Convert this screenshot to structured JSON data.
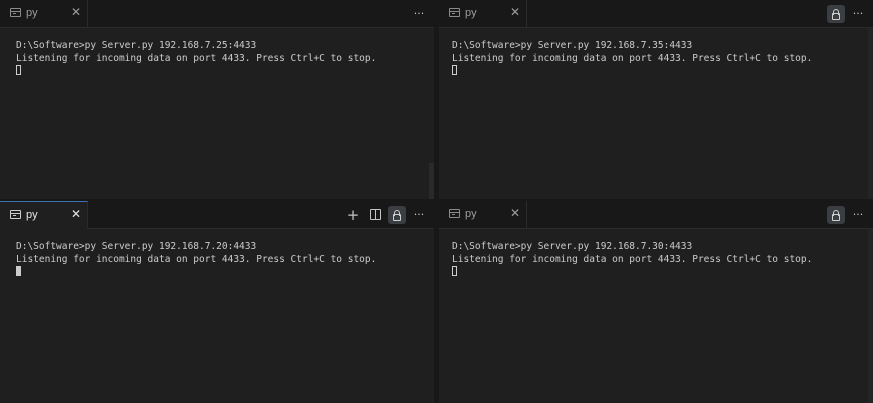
{
  "panes": {
    "top_left": {
      "tab_label": "py",
      "prompt": "D:\\Software>py Server.py 192.168.7.25:4433",
      "output": "Listening for incoming data on port 4433. Press Ctrl+C to stop."
    },
    "top_right": {
      "tab_label": "py",
      "prompt": "D:\\Software>py Server.py 192.168.7.35:4433",
      "output": "Listening for incoming data on port 4433. Press Ctrl+C to stop."
    },
    "bottom_left": {
      "tab_label": "py",
      "prompt": "D:\\Software>py Server.py 192.168.7.20:4433",
      "output": "Listening for incoming data on port 4433. Press Ctrl+C to stop."
    },
    "bottom_right": {
      "tab_label": "py",
      "prompt": "D:\\Software>py Server.py 192.168.7.30:4433",
      "output": "Listening for incoming data on port 4433. Press Ctrl+C to stop."
    }
  },
  "icons": {
    "close": "close-icon",
    "more": "more-actions-icon",
    "lock": "lock-icon",
    "split": "split-editor-icon",
    "add": "plus-icon",
    "terminal": "terminal-icon"
  },
  "glyphs": {
    "close": "✕",
    "more": "···",
    "add": "+"
  },
  "colors": {
    "background": "#1f1f1f",
    "tab_bar": "#181818",
    "active_tab_border": "#3b6fb6",
    "text": "#cccccc"
  }
}
